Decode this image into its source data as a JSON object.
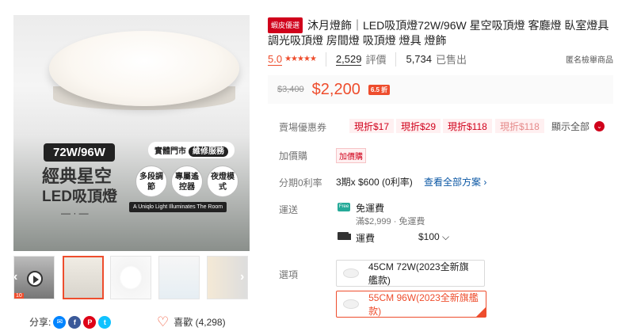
{
  "gallery": {
    "promo_size": "72W/96W",
    "promo_title_1": "經典星空",
    "promo_title_2": "LED吸頂燈",
    "promo_dash": "— · —",
    "store_badge_a": "實體門市",
    "store_badge_b": "維修服務",
    "feature_1": "多段調節",
    "feature_2": "專屬遙控器",
    "feature_3": "夜燈模式",
    "slogan": "A Uniqlo Light Illuminates The Room",
    "prev_icon": "chevron-left-icon",
    "next_icon": "chevron-right-icon",
    "thumb_badge": "10"
  },
  "share": {
    "label": "分享:"
  },
  "like": {
    "label": "喜歡 (4,298)"
  },
  "product": {
    "mall_tag": "蝦皮優選",
    "title": "沐月燈飾｜LED吸頂燈72W/96W 星空吸頂燈 客廳燈 臥室燈具 調光吸頂燈 房間燈 吸頂燈 燈具 燈飾"
  },
  "rating": {
    "score": "5.0",
    "stars": "★★★★★",
    "reviews_count": "2,529",
    "reviews_label": "評價",
    "sold_count": "5,734",
    "sold_label": "已售出",
    "report": "匿名檢舉商品"
  },
  "price": {
    "original": "$3,400",
    "current": "$2,200",
    "discount": "6.5 折"
  },
  "coupons": {
    "label": "賣場優惠券",
    "items": [
      "現折$17",
      "現折$29",
      "現折$118",
      "現折$118"
    ],
    "show_all": "顯示全部"
  },
  "addon": {
    "label": "加價購",
    "tag": "加價購"
  },
  "installment": {
    "label": "分期0利率",
    "value": "3期x $600 (0利率)",
    "link": "查看全部方案 ›"
  },
  "shipping": {
    "label": "運送",
    "free_icon_text": "Free",
    "free": "免運費",
    "free_sub": "滿$2,999 · 免運費",
    "fee_label": "運費",
    "fee_value": "$100 ⌵"
  },
  "options": {
    "label": "選項",
    "items": [
      "45CM 72W(2023全新旗艦款)",
      "55CM 96W(2023全新旗艦款)"
    ],
    "selected_index": 1
  },
  "colors": {
    "accent": "#ee4d2d",
    "mall": "#d0011b",
    "link": "#0b57a4"
  }
}
